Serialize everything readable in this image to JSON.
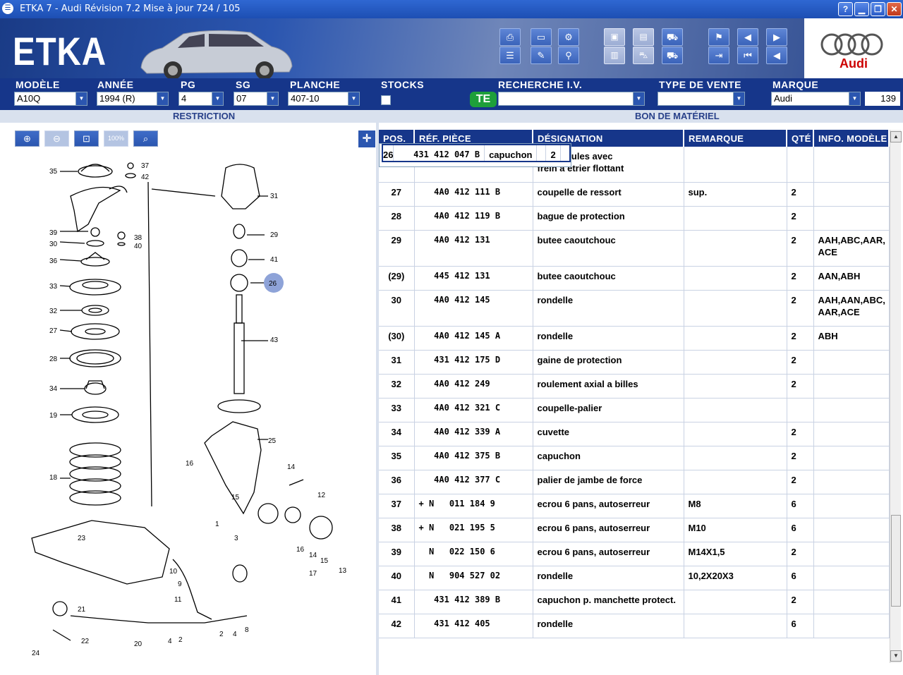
{
  "window": {
    "title": "ETKA 7 - Audi Révision 7.2 Mise à jour 724 / 105",
    "help": "?",
    "minimize": "▁",
    "maximize": "❐",
    "close": "✕"
  },
  "banner": {
    "logo": "ETKA",
    "brand": "Audi"
  },
  "fields": {
    "model": {
      "label": "MODÈLE",
      "value": "A10Q"
    },
    "year": {
      "label": "ANNÉE",
      "value": "1994 (R)"
    },
    "pg": {
      "label": "PG",
      "value": "4"
    },
    "sg": {
      "label": "SG",
      "value": "07"
    },
    "plate": {
      "label": "PLANCHE",
      "value": "407-10"
    },
    "stocks": {
      "label": "STOCKS"
    },
    "search": {
      "label": "RECHERCHE I.V.",
      "badge": "TE",
      "value": ""
    },
    "sale_type": {
      "label": "TYPE DE VENTE",
      "value": ""
    },
    "brand": {
      "label": "MARQUE",
      "value": "Audi"
    },
    "count": "139"
  },
  "subbar": {
    "restriction": "RESTRICTION",
    "bom": "BON DE MATÉRIEL"
  },
  "zoom_buttons": [
    {
      "name": "zoom-in-icon",
      "glyph": "⊕"
    },
    {
      "name": "zoom-out-icon",
      "glyph": "⊖"
    },
    {
      "name": "zoom-area-icon",
      "glyph": "⊡"
    },
    {
      "name": "zoom-100-icon",
      "glyph": "100%"
    },
    {
      "name": "search-icon",
      "glyph": "⌕"
    }
  ],
  "diagram": {
    "callouts": [
      "35",
      "37",
      "42",
      "39",
      "38",
      "30",
      "40",
      "36",
      "33",
      "32",
      "27",
      "28",
      "34",
      "19",
      "18",
      "31",
      "29",
      "41",
      "26",
      "43",
      "25",
      "16",
      "14",
      "15",
      "12",
      "1",
      "3",
      "16",
      "14",
      "15",
      "13",
      "17",
      "23",
      "10",
      "9",
      "11",
      "21",
      "20",
      "22",
      "24",
      "4",
      "2",
      "2",
      "4",
      "8"
    ]
  },
  "table": {
    "columns": [
      "POS.",
      "RÉF. PIÈCE",
      "DÉSIGNATION",
      "REMARQUE",
      "QTÉ",
      "INFO. MODÈLE"
    ],
    "rows": [
      {
        "pos": "",
        "ref": "",
        "des": "p. vehicules avec\nfrein a etrier flottant",
        "rem": "",
        "qty": "",
        "info": ""
      },
      {
        "pos": "26",
        "ref": "   431 412 047 B",
        "des": "capuchon",
        "rem": "",
        "qty": "2",
        "info": "",
        "selected": true
      },
      {
        "pos": "27",
        "ref": "   4A0 412 111 B",
        "des": "coupelle de ressort",
        "rem": "sup.",
        "qty": "2",
        "info": ""
      },
      {
        "pos": "28",
        "ref": "   4A0 412 119 B",
        "des": "bague de protection",
        "rem": "",
        "qty": "2",
        "info": ""
      },
      {
        "pos": "29",
        "ref": "   4A0 412 131",
        "des": "butee caoutchouc",
        "rem": "",
        "qty": "2",
        "info": "AAH,ABC,AAR,\nACE"
      },
      {
        "pos": "(29)",
        "ref": "   445 412 131",
        "des": "butee caoutchouc",
        "rem": "",
        "qty": "2",
        "info": "AAN,ABH"
      },
      {
        "pos": "30",
        "ref": "   4A0 412 145",
        "des": "rondelle",
        "rem": "",
        "qty": "2",
        "info": "AAH,AAN,ABC,\nAAR,ACE"
      },
      {
        "pos": "(30)",
        "ref": "   4A0 412 145 A",
        "des": "rondelle",
        "rem": "",
        "qty": "2",
        "info": "ABH"
      },
      {
        "pos": "31",
        "ref": "   431 412 175 D",
        "des": "gaine de protection",
        "rem": "",
        "qty": "2",
        "info": ""
      },
      {
        "pos": "32",
        "ref": "   4A0 412 249",
        "des": "roulement axial a billes",
        "rem": "",
        "qty": "2",
        "info": ""
      },
      {
        "pos": "33",
        "ref": "   4A0 412 321 C",
        "des": "coupelle-palier",
        "rem": "",
        "qty": "",
        "info": ""
      },
      {
        "pos": "34",
        "ref": "   4A0 412 339 A",
        "des": "cuvette",
        "rem": "",
        "qty": "2",
        "info": ""
      },
      {
        "pos": "35",
        "ref": "   4A0 412 375 B",
        "des": "capuchon",
        "rem": "",
        "qty": "2",
        "info": ""
      },
      {
        "pos": "36",
        "ref": "   4A0 412 377 C",
        "des": "palier de jambe de force",
        "rem": "",
        "qty": "2",
        "info": ""
      },
      {
        "pos": "37",
        "ref": "+ N   011 184 9",
        "des": "ecrou 6 pans, autoserreur",
        "rem": "M8",
        "qty": "6",
        "info": ""
      },
      {
        "pos": "38",
        "ref": "+ N   021 195 5",
        "des": "ecrou 6 pans, autoserreur",
        "rem": "M10",
        "qty": "6",
        "info": ""
      },
      {
        "pos": "39",
        "ref": "  N   022 150 6",
        "des": "ecrou 6 pans, autoserreur",
        "rem": "M14X1,5",
        "qty": "2",
        "info": ""
      },
      {
        "pos": "40",
        "ref": "  N   904 527 02",
        "des": "rondelle",
        "rem": "10,2X20X3",
        "qty": "6",
        "info": ""
      },
      {
        "pos": "41",
        "ref": "   431 412 389 B",
        "des": "capuchon p. manchette protect.",
        "rem": "",
        "qty": "2",
        "info": ""
      },
      {
        "pos": "42",
        "ref": "   431 412 405",
        "des": "rondelle",
        "rem": "",
        "qty": "6",
        "info": ""
      }
    ]
  }
}
